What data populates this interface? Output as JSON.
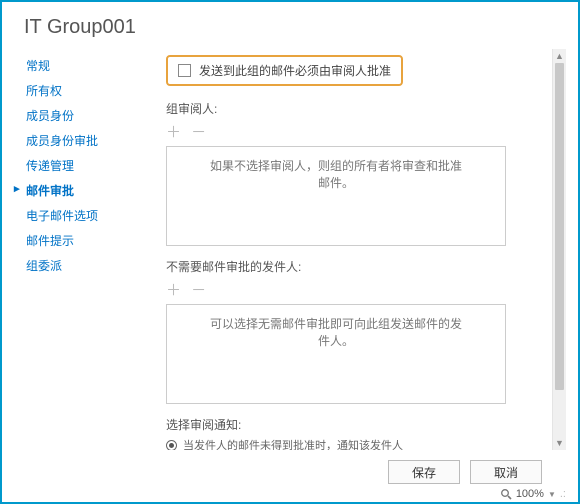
{
  "window_title": "IT Group001",
  "sidebar": {
    "items": [
      {
        "label": "常规"
      },
      {
        "label": "所有权"
      },
      {
        "label": "成员身份"
      },
      {
        "label": "成员身份审批"
      },
      {
        "label": "传递管理"
      },
      {
        "label": "邮件审批",
        "active": true
      },
      {
        "label": "电子邮件选项"
      },
      {
        "label": "邮件提示"
      },
      {
        "label": "组委派"
      }
    ]
  },
  "main": {
    "require_approval_label": "发送到此组的邮件必须由审阅人批准",
    "moderators_label": "组审阅人:",
    "addremove_glyph": "＋ －",
    "moderators_placeholder": "如果不选择审阅人，则组的所有者将审查和批准邮件。",
    "bypass_label": "不需要邮件审批的发件人:",
    "bypass_placeholder": "可以选择无需邮件审批即可向此组发送邮件的发件人。",
    "notify_label": "选择审阅通知:",
    "notify_option1": "当发件人的邮件未得到批准时，通知该发件人"
  },
  "footer": {
    "save_label": "保存",
    "cancel_label": "取消"
  },
  "statusbar": {
    "zoom": "100%"
  }
}
